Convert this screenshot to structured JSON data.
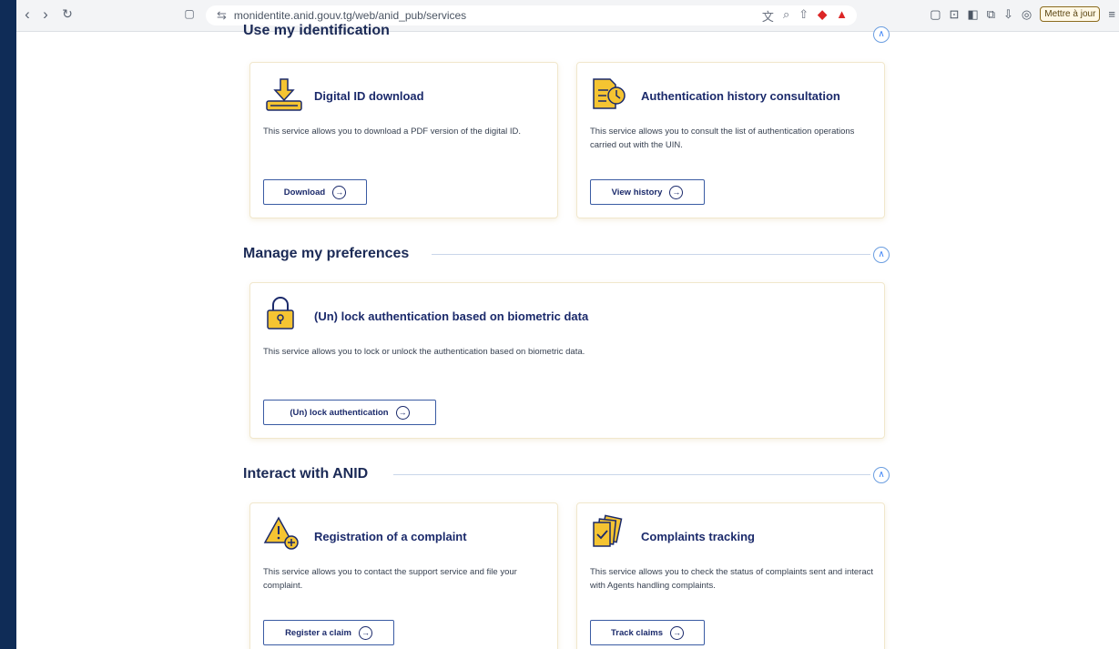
{
  "browser": {
    "url": "monidentite.anid.gouv.tg/web/anid_pub/services",
    "update_label": "Mettre à jour"
  },
  "sections": {
    "identification": {
      "title": "Use my identification"
    },
    "preferences": {
      "title": "Manage my preferences"
    },
    "interact": {
      "title": "Interact with ANID"
    }
  },
  "cards": {
    "digital_id": {
      "title": "Digital ID download",
      "desc": "This service allows you to download a PDF version of the digital ID.",
      "button": "Download"
    },
    "auth_history": {
      "title": "Authentication history consultation",
      "desc": "This service allows you to consult the list of authentication operations carried out with the UIN.",
      "button": "View history"
    },
    "lock_auth": {
      "title": "(Un) lock authentication based on biometric data",
      "desc": "This service allows you to lock or unlock the authentication based on biometric data.",
      "button": "(Un) lock authentication"
    },
    "complaint": {
      "title": "Registration of a complaint",
      "desc": "This service allows you to contact the support service and file your complaint.",
      "button": "Register a claim"
    },
    "tracking": {
      "title": "Complaints tracking",
      "desc": "This service allows you to check the status of complaints sent and interact with Agents handling complaints.",
      "button": "Track claims"
    }
  },
  "colors": {
    "accent": "#1b2a6b",
    "icon_yellow": "#f5c432",
    "page_bg": "#0f2c57"
  }
}
